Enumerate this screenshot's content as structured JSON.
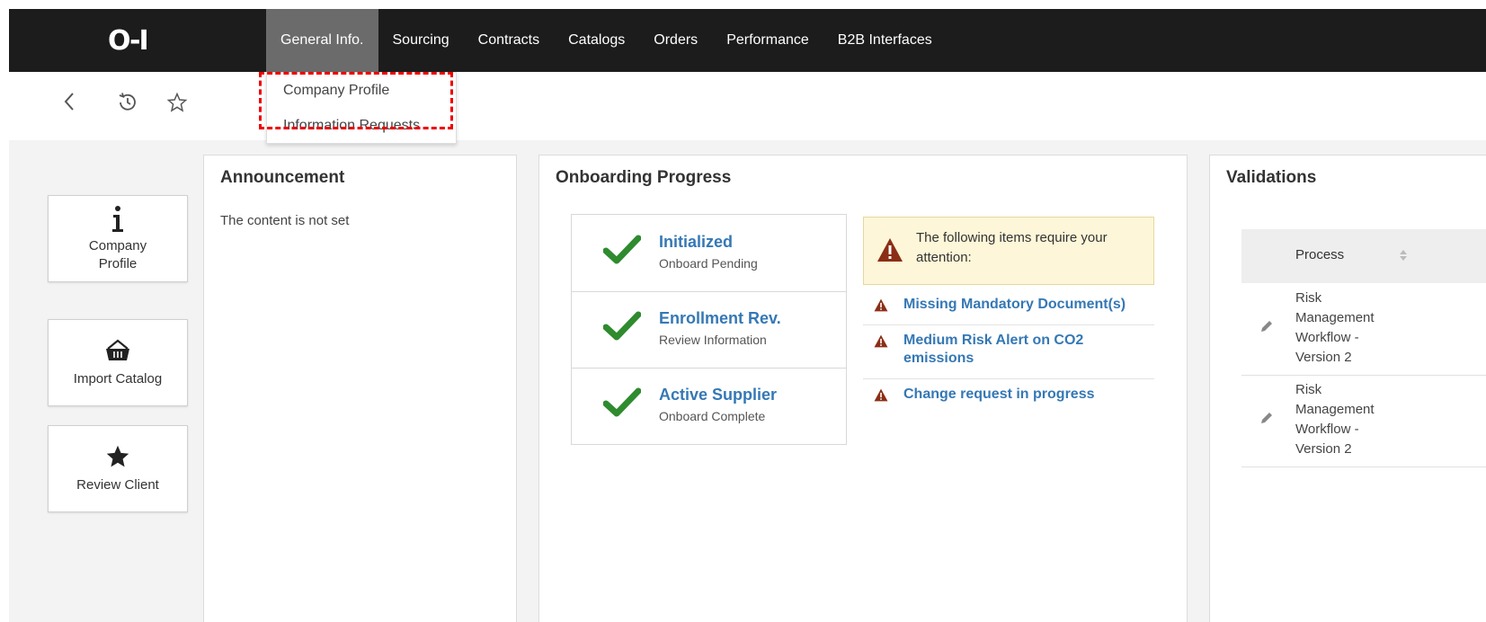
{
  "header": {
    "logo": "O-I",
    "nav": [
      {
        "label": "General Info.",
        "active": true
      },
      {
        "label": "Sourcing"
      },
      {
        "label": "Contracts"
      },
      {
        "label": "Catalogs"
      },
      {
        "label": "Orders"
      },
      {
        "label": "Performance"
      },
      {
        "label": "B2B Interfaces"
      }
    ],
    "dropdown": [
      "Company Profile",
      "Information Requests"
    ]
  },
  "toolbar": {
    "icons": [
      "back-icon",
      "history-icon",
      "star-icon"
    ]
  },
  "tiles": [
    {
      "label": "Company Profile",
      "icon": "info-icon"
    },
    {
      "label": "Import Catalog",
      "icon": "basket-icon"
    },
    {
      "label": "Review Client",
      "icon": "star-icon"
    }
  ],
  "announcement": {
    "title": "Announcement",
    "text": "The content is not set"
  },
  "onboarding": {
    "title": "Onboarding Progress",
    "steps": [
      {
        "title": "Initialized",
        "subtitle": "Onboard Pending"
      },
      {
        "title": "Enrollment Rev.",
        "subtitle": "Review Information"
      },
      {
        "title": "Active Supplier",
        "subtitle": "Onboard Complete"
      }
    ],
    "attention_text": "The following items require your attention:",
    "attention_items": [
      "Missing Mandatory Document(s)",
      "Medium Risk Alert on CO2 emissions",
      "Change request in progress"
    ]
  },
  "validations": {
    "title": "Validations",
    "column": "Process",
    "rows": [
      "Risk Management Workflow - Version 2",
      "Risk Management Workflow - Version 2"
    ]
  },
  "colors": {
    "topbar": "#1c1c1c",
    "link": "#3578b5",
    "check": "#2e8b2e",
    "warning": "#8b2e16",
    "highlight": "#e00000"
  }
}
